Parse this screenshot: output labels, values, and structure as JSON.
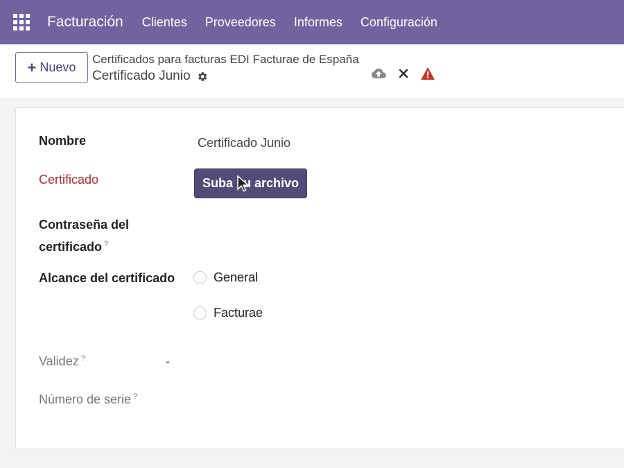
{
  "navbar": {
    "apps_icon": "apps-grid-icon",
    "brand": "Facturación",
    "menu": [
      "Clientes",
      "Proveedores",
      "Informes",
      "Configuración"
    ]
  },
  "control_panel": {
    "new_button": "Nuevo",
    "breadcrumb": "Certificados para facturas EDI Facturae de España",
    "record_name": "Certificado Junio",
    "icons": [
      "gear-icon",
      "cloud-upload-icon",
      "discard-x-icon",
      "warning-icon"
    ]
  },
  "form": {
    "nombre_label": "Nombre",
    "nombre_value": "Certificado Junio",
    "certificado_label": "Certificado",
    "upload_button": "Suba su archivo",
    "password_label_line1": "Contraseña del",
    "password_label_line2": "certificado",
    "help_mark": "?",
    "alcance_label": "Alcance del certificado",
    "alcance_options": [
      "General",
      "Facturae"
    ],
    "validez_label": "Validez",
    "validez_value": "-",
    "serie_label": "Número de serie"
  },
  "colors": {
    "navbar": "#71639e",
    "primary_button": "#544b79",
    "required_error": "#a94442",
    "warning": "#c0392b"
  }
}
